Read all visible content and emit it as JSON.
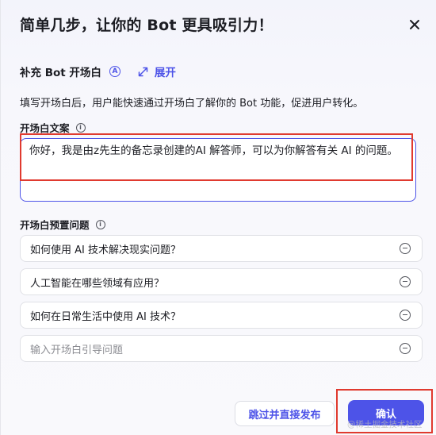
{
  "dialog": {
    "title": "简单几步，让你的 Bot 更具吸引力！",
    "close_icon": "close-icon"
  },
  "section": {
    "title": "补充 Bot 开场白",
    "badge_icon": "circle-a-icon",
    "expand_icon": "expand-arrows-icon",
    "expand_label": "展开",
    "description": "填写开场白后，用户能快速通过开场白了解你的 Bot 功能，促进用户转化。"
  },
  "opening_text": {
    "label": "开场白文案",
    "info_icon": "info-icon",
    "value": "你好，我是由z先生的备忘录创建的AI 解答师，可以为你解答有关 AI 的问题。"
  },
  "preset_questions": {
    "label": "开场白预置问题",
    "info_icon": "info-icon",
    "items": [
      "如何使用 AI 技术解决现实问题？",
      "人工智能在哪些领域有应用？",
      "如何在日常生活中使用 AI 技术？"
    ],
    "placeholder": "输入开场白引导问题",
    "remove_icon": "minus-circle-icon"
  },
  "footer": {
    "skip_label": "跳过并直接发布",
    "confirm_label": "确认"
  },
  "watermark": "@稀土掘金技术社区",
  "colors": {
    "accent": "#4d53e8",
    "annotation_red": "#e03a2f",
    "text": "#1c1d23"
  }
}
